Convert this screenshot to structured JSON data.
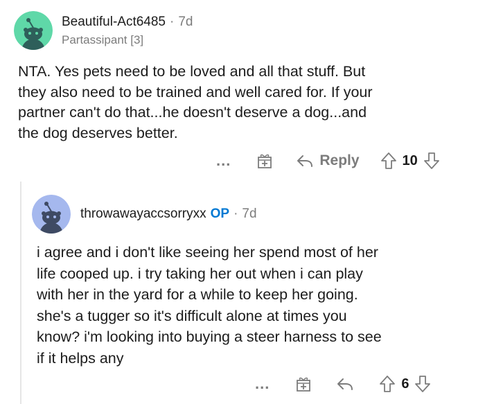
{
  "comment1": {
    "username": "Beautiful-Act6485",
    "age": "7d",
    "flair": "Partassipant [3]",
    "body_lines": [
      "NTA. Yes pets need to be loved and all that stuff. But",
      "they also need to be trained and well cared for. If your",
      "partner can't do that...he doesn't deserve a dog...and",
      "the dog deserves better."
    ],
    "more_label": "...",
    "reply_label": "Reply",
    "score": "10",
    "avatar_color": "#5fd8a8"
  },
  "comment2": {
    "username": "throwawayaccsorryxx",
    "op_badge": "OP",
    "age": "7d",
    "body_lines": [
      "i agree and i don't like seeing her spend most of her",
      "life cooped up. i try taking her out when i can play",
      "with her in the yard for a while to keep her going.",
      "she's a tugger so it's difficult alone at times you",
      "know? i'm looking into buying a steer harness to see",
      "if it helps any"
    ],
    "more_label": "...",
    "score": "6",
    "avatar_color": "#a5b8ee"
  },
  "colors": {
    "op_blue": "#0079d3",
    "muted": "#7c7c7c",
    "thread_line": "#e6e6e6"
  },
  "icons": [
    "snoo-avatar-icon",
    "award-gift-icon",
    "reply-arrow-icon",
    "upvote-arrow-icon",
    "downvote-arrow-icon"
  ]
}
